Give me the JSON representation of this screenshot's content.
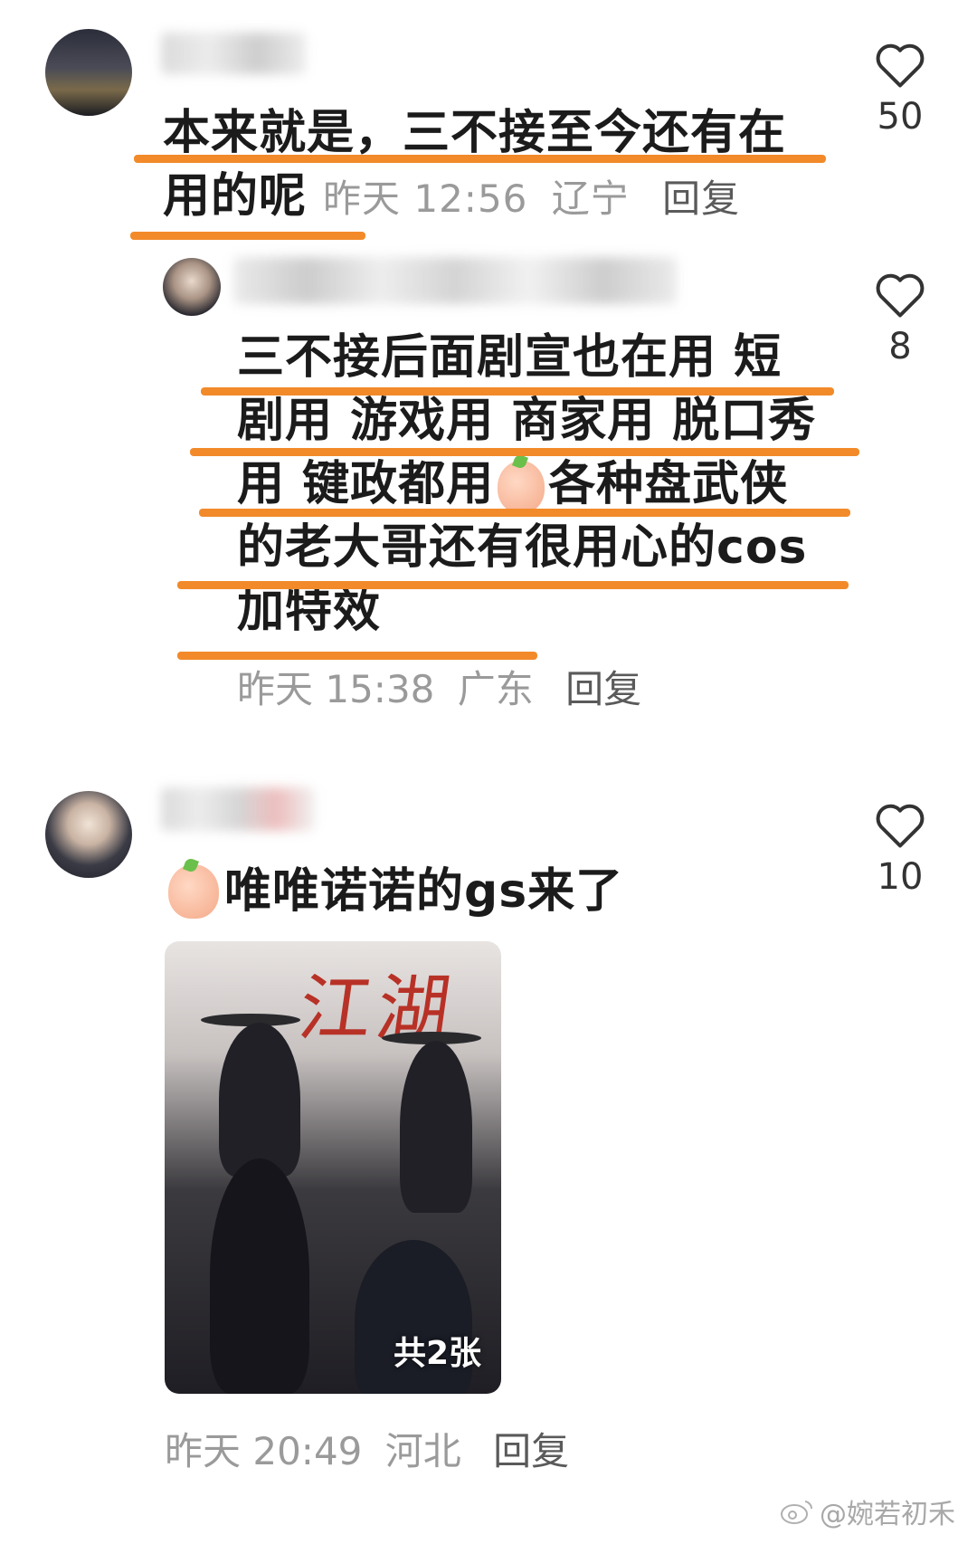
{
  "comments": [
    {
      "text_lines": [
        "本来就是，三不接至今还有在",
        "用的呢"
      ],
      "time": "昨天 12:56",
      "location": "辽宁",
      "reply_label": "回复",
      "likes": "50"
    },
    {
      "text_lines": [
        "三不接后面剧宣也在用 短",
        "剧用 游戏用 商家用 脱口秀",
        "用 键政都用",
        "各种盘武侠",
        "的老大哥还有很用心的cos",
        "加特效"
      ],
      "time": "昨天 15:38",
      "location": "广东",
      "reply_label": "回复",
      "likes": "8"
    },
    {
      "text": "唯唯诺诺的gs来了",
      "image_badge": "共2张",
      "poster_title": "江湖",
      "time": "昨天 20:49",
      "location": "河北",
      "reply_label": "回复",
      "likes": "10"
    }
  ],
  "watermark": "@婉若初禾",
  "colors": {
    "underline": "#f28a2a",
    "meta": "#9a9a9a"
  },
  "icons": [
    "heart-outline-icon",
    "emoji-peach-icon",
    "weibo-logo-icon"
  ]
}
